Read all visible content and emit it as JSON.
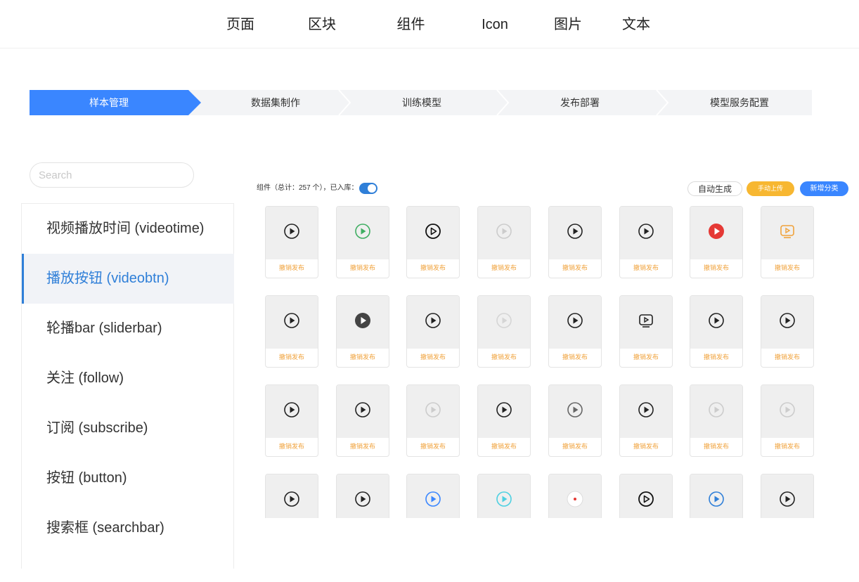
{
  "nav": [
    {
      "label": "页面",
      "active": false
    },
    {
      "label": "区块",
      "active": false
    },
    {
      "label": "组件",
      "active": true
    },
    {
      "label": "Icon",
      "active": false
    },
    {
      "label": "图片",
      "active": false
    },
    {
      "label": "文本",
      "active": false
    }
  ],
  "steps": [
    "样本管理",
    "数据集制作",
    "训练模型",
    "发布部署",
    "模型服务配置"
  ],
  "search": {
    "placeholder": "Search",
    "value": ""
  },
  "sidebar": [
    {
      "label": "视频播放时间 (videotime)",
      "active": false
    },
    {
      "label": "播放按钮 (videobtn)",
      "active": true
    },
    {
      "label": "轮播bar (sliderbar)",
      "active": false
    },
    {
      "label": "关注 (follow)",
      "active": false
    },
    {
      "label": "订阅 (subscribe)",
      "active": false
    },
    {
      "label": "按钮 (button)",
      "active": false
    },
    {
      "label": "搜索框 (searchbar)",
      "active": false
    }
  ],
  "toolbar": {
    "summary": "组件（总计：257 个），已入库：",
    "in_library_enabled": true,
    "auto_generate": "自动生成",
    "manual_upload": "手动上传",
    "new_category": "新增分类"
  },
  "colors": {
    "accent": "#c47c3a",
    "primary": "#3a86ff",
    "link": "#2f7fd8",
    "warn": "#f0a23b",
    "upload": "#f7b731"
  },
  "card_action_label": "撤销发布",
  "cards": [
    {
      "icon": "play-circle-icon",
      "color": "#222222"
    },
    {
      "icon": "play-circle-icon",
      "color": "#3fae62"
    },
    {
      "icon": "play-outline-icon",
      "color": "#111111"
    },
    {
      "icon": "play-circle-faded-icon",
      "color": "#cccccc"
    },
    {
      "icon": "play-circle-icon",
      "color": "#222222"
    },
    {
      "icon": "play-circle-icon",
      "color": "#222222"
    },
    {
      "icon": "play-filled-red-icon",
      "color": "#e53935"
    },
    {
      "icon": "screen-play-icon",
      "color": "#f0a23b"
    },
    {
      "icon": "play-circle-icon",
      "color": "#222222"
    },
    {
      "icon": "play-filled-dark-icon",
      "color": "#444444"
    },
    {
      "icon": "play-circle-icon",
      "color": "#222222"
    },
    {
      "icon": "play-circle-faded-icon",
      "color": "#d5d5d5"
    },
    {
      "icon": "play-circle-icon",
      "color": "#222222"
    },
    {
      "icon": "screen-play-icon",
      "color": "#222222"
    },
    {
      "icon": "play-circle-icon",
      "color": "#222222"
    },
    {
      "icon": "play-circle-icon",
      "color": "#222222"
    },
    {
      "icon": "play-circle-icon",
      "color": "#222222"
    },
    {
      "icon": "play-circle-icon",
      "color": "#222222"
    },
    {
      "icon": "play-circle-faded-icon",
      "color": "#cccccc"
    },
    {
      "icon": "play-circle-icon",
      "color": "#222222"
    },
    {
      "icon": "play-circle-icon",
      "color": "#666666"
    },
    {
      "icon": "play-circle-icon",
      "color": "#222222"
    },
    {
      "icon": "play-circle-faded-icon",
      "color": "#cccccc"
    },
    {
      "icon": "play-circle-faded-icon",
      "color": "#cccccc"
    },
    {
      "icon": "play-circle-icon",
      "color": "#222222"
    },
    {
      "icon": "play-circle-icon",
      "color": "#222222"
    },
    {
      "icon": "play-circle-icon",
      "color": "#3a86ff"
    },
    {
      "icon": "play-circle-icon",
      "color": "#4dd0e1"
    },
    {
      "icon": "record-dot-icon",
      "color": "#e53935"
    },
    {
      "icon": "play-outline-icon",
      "color": "#111111"
    },
    {
      "icon": "play-circle-icon",
      "color": "#2f7fd8"
    },
    {
      "icon": "play-circle-icon",
      "color": "#222222"
    }
  ]
}
